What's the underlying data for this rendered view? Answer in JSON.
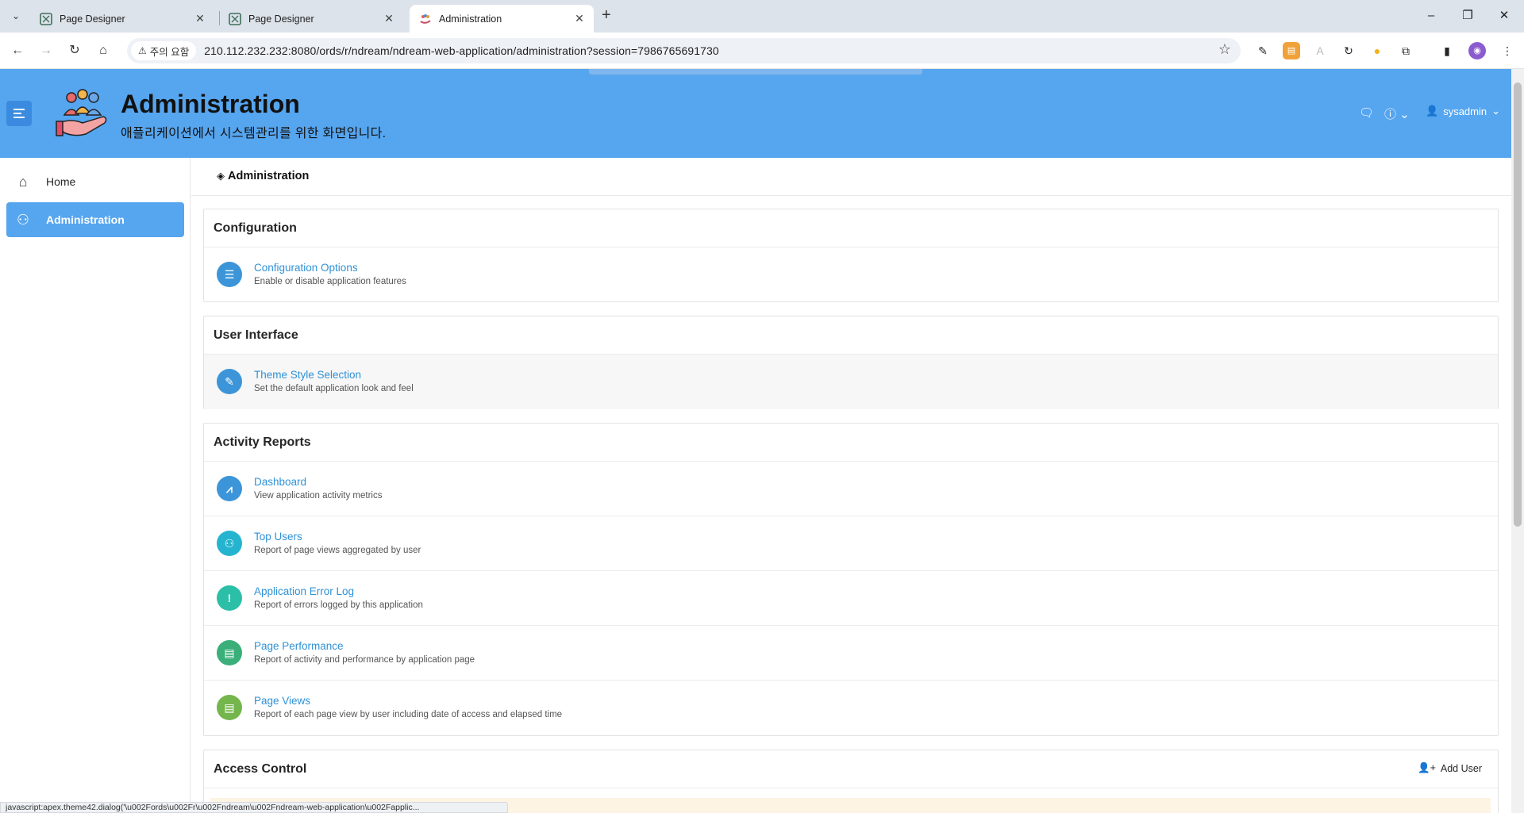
{
  "browser": {
    "tabs": [
      {
        "title": "Page Designer",
        "active": false
      },
      {
        "title": "Page Designer",
        "active": false
      },
      {
        "title": "Administration",
        "active": true
      }
    ],
    "security_chip": "주의 요함",
    "url": "210.112.232.232:8080/ords/r/ndream/ndream-web-application/administration?session=7986765691730",
    "status_url": "javascript:apex.theme42.dialog('\\u002Fords\\u002Fr\\u002Fndream\\u002Fndream-web-application\\u002Fapplic..."
  },
  "header": {
    "title": "Administration",
    "subtitle": "애플리케이션에서 시스템관리를 위한 화면입니다.",
    "user": "sysadmin"
  },
  "sidebar": {
    "items": [
      {
        "label": "Home",
        "icon": "home-icon",
        "active": false
      },
      {
        "label": "Administration",
        "icon": "user-wrench-icon",
        "active": true
      }
    ]
  },
  "breadcrumb": {
    "current": "Administration"
  },
  "regions": {
    "configuration": {
      "title": "Configuration",
      "items": [
        {
          "title": "Configuration Options",
          "desc": "Enable or disable application features",
          "icon": "sliders-icon",
          "color": "#3c95d8"
        }
      ]
    },
    "user_interface": {
      "title": "User Interface",
      "items": [
        {
          "title": "Theme Style Selection",
          "desc": "Set the default application look and feel",
          "icon": "brush-icon",
          "color": "#3c95d8"
        }
      ]
    },
    "activity_reports": {
      "title": "Activity Reports",
      "items": [
        {
          "title": "Dashboard",
          "desc": "View application activity metrics",
          "icon": "chart-icon",
          "color": "#3c95d8"
        },
        {
          "title": "Top Users",
          "desc": "Report of page views aggregated by user",
          "icon": "user-chart-icon",
          "color": "#25b4cf"
        },
        {
          "title": "Application Error Log",
          "desc": "Report of errors logged by this application",
          "icon": "exclamation-icon",
          "color": "#2bbfa8"
        },
        {
          "title": "Page Performance",
          "desc": "Report of activity and performance by application page",
          "icon": "file-chart-icon",
          "color": "#3aaf7a"
        },
        {
          "title": "Page Views",
          "desc": "Report of each page view by user including date of access and elapsed time",
          "icon": "file-search-icon",
          "color": "#74b54c"
        }
      ]
    },
    "access_control": {
      "title": "Access Control",
      "action_label": "Add User"
    }
  }
}
